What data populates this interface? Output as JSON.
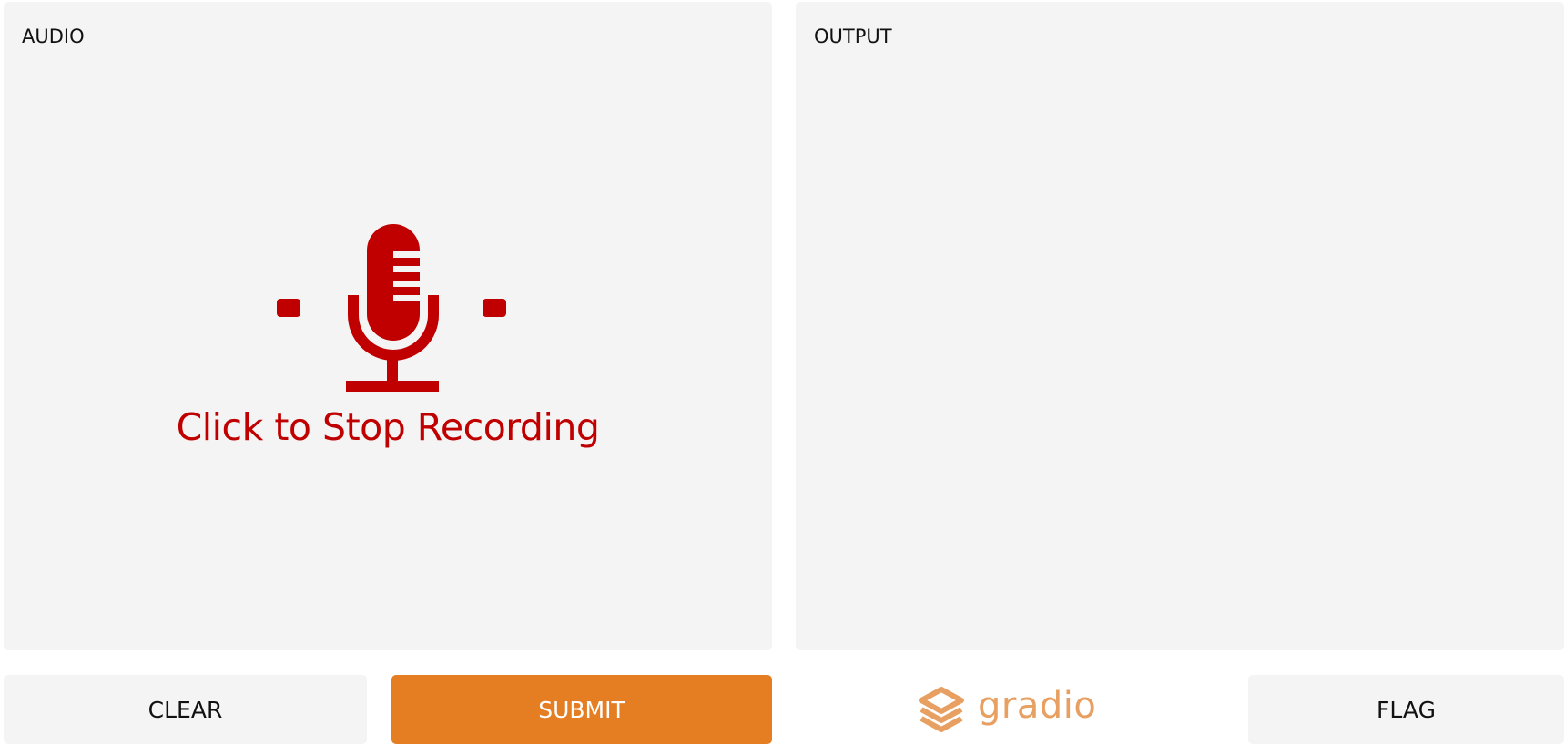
{
  "audio": {
    "label": "AUDIO",
    "recorder": {
      "icon": "microphone-icon",
      "status_text": "Click to Stop Recording",
      "color": "#c00000"
    }
  },
  "output": {
    "label": "OUTPUT"
  },
  "buttons": {
    "clear_label": "CLEAR",
    "submit_label": "SUBMIT",
    "flag_label": "FLAG"
  },
  "brand": {
    "name": "gradio",
    "icon": "gradio-logo-icon",
    "color": "#e8a062"
  },
  "colors": {
    "accent": "#e57e22",
    "panel_bg": "#f4f4f4",
    "recording": "#c00000"
  }
}
